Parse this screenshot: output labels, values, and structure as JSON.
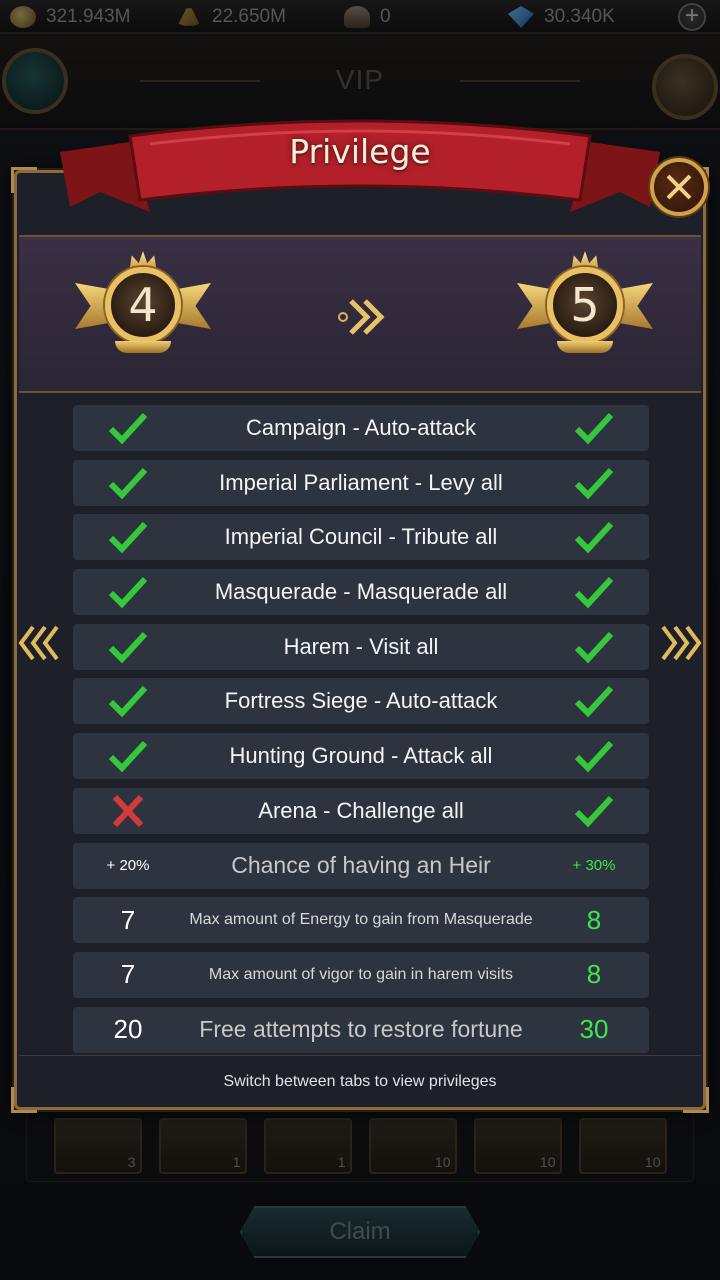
{
  "resources": {
    "silver": "321.943M",
    "food": "22.650M",
    "soldiers": "0",
    "gems": "30.340K"
  },
  "header": {
    "title": "VIP"
  },
  "modal": {
    "title": "Privilege",
    "from_level": "4",
    "to_level": "5",
    "footer": "Switch between tabs to view privileges"
  },
  "privileges": [
    {
      "label": "Campaign - Auto-attack",
      "from": "check",
      "to": "check"
    },
    {
      "label": "Imperial Parliament - Levy all",
      "from": "check",
      "to": "check"
    },
    {
      "label": "Imperial Council - Tribute all",
      "from": "check",
      "to": "check"
    },
    {
      "label": "Masquerade - Masquerade all",
      "from": "check",
      "to": "check"
    },
    {
      "label": "Harem - Visit all",
      "from": "check",
      "to": "check"
    },
    {
      "label": "Fortress Siege - Auto-attack",
      "from": "check",
      "to": "check"
    },
    {
      "label": "Hunting Ground - Attack all",
      "from": "check",
      "to": "check"
    },
    {
      "label": "Arena - Challenge all",
      "from": "cross",
      "to": "check"
    }
  ],
  "stats": [
    {
      "label": "Chance of having an Heir",
      "from": "+ 20%",
      "to": "+ 30%"
    },
    {
      "label": "Max amount of Energy to gain from Masquerade",
      "from": "7",
      "to": "8"
    },
    {
      "label": "Max amount of vigor to gain in harem visits",
      "from": "7",
      "to": "8"
    },
    {
      "label": "Free attempts to restore fortune",
      "from": "20",
      "to": "30"
    }
  ],
  "rewards": [
    {
      "icon": "coin-pouch-icon",
      "count": "3"
    },
    {
      "icon": "purple-bag-icon",
      "count": "1"
    },
    {
      "icon": "exp-scroll-icon",
      "count": "1"
    },
    {
      "icon": "potion-icon",
      "count": "10"
    },
    {
      "icon": "buns-icon",
      "count": "10"
    },
    {
      "icon": "treasure-box-icon",
      "count": "10"
    }
  ],
  "claim_label": "Claim",
  "colors": {
    "check_green": "#35c83c",
    "cross_red": "#d43a3a",
    "upgrade_value": "#3ee84a",
    "gold_border": "#8a6a3e",
    "ribbon_red": "#b3202a"
  }
}
